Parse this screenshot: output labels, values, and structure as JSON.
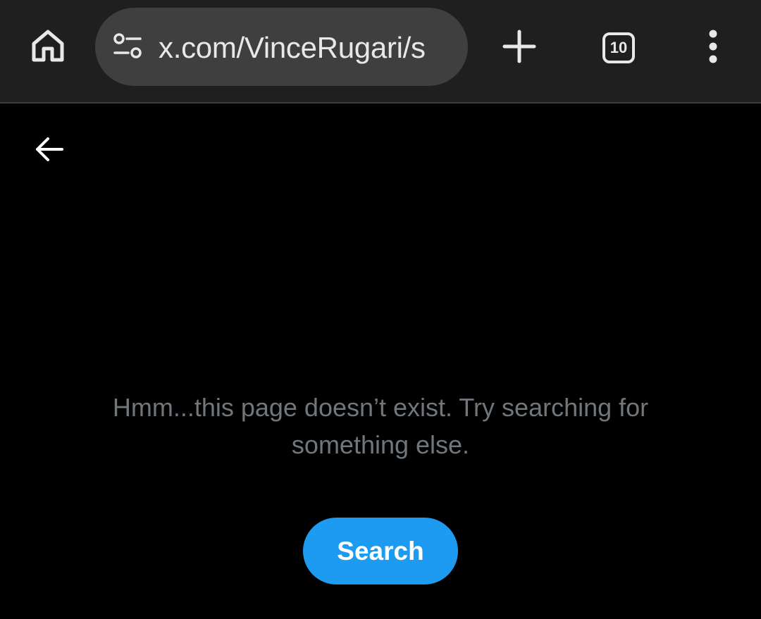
{
  "browser": {
    "url": "x.com/VinceRugari/s",
    "tab_count": "10",
    "icons": {
      "home": "home-icon",
      "site_settings": "tune-icon",
      "new_tab": "plus-icon",
      "tabs": "tab-switcher-icon",
      "menu": "more-vert-icon"
    }
  },
  "page": {
    "back_icon": "arrow-left-icon",
    "message": "Hmm...this page doesn’t exist. Try searching for something else.",
    "search_button_label": "Search"
  },
  "colors": {
    "toolbar_bg": "#1f1f1f",
    "omnibox_bg": "#3f3f3f",
    "page_bg": "#000000",
    "message_text": "#71767b",
    "accent": "#1d9bf0"
  }
}
